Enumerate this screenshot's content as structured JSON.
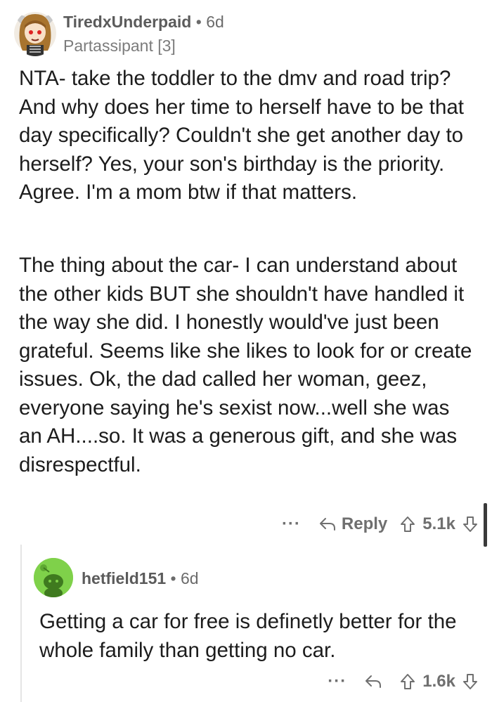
{
  "comment": {
    "username": "TiredxUnderpaid",
    "separator": "•",
    "time": "6d",
    "flair": "Partassipant [3]",
    "paragraphs": [
      "NTA- take the toddler to the dmv and road trip? And why does her time to herself have to be that day specifically? Couldn't she get another day to herself? Yes, your son's birthday is the priority. Agree. I'm a mom btw if that matters.",
      "The thing about the car- I can understand about the other kids BUT she shouldn't have handled it the way she did. I honestly would've just been grateful. Seems like she likes to look for or create issues. Ok, the dad called her woman, geez, everyone saying he's sexist now...well she was an AH....so. It was a generous gift, and she was disrespectful."
    ],
    "actions": {
      "more": "···",
      "reply_label": "Reply",
      "score": "5.1k"
    }
  },
  "reply": {
    "username": "hetfield151",
    "separator": "•",
    "time": "6d",
    "body": "Getting a car for free is definetly better for the whole family than getting no car.",
    "actions": {
      "more": "···",
      "score": "1.6k"
    }
  },
  "icons": {
    "reply": "reply-arrow-icon",
    "upvote": "upvote-arrow-icon",
    "downvote": "downvote-arrow-icon"
  },
  "colors": {
    "meta_text": "#6b6b6b",
    "body_text": "#1c1c1c",
    "reply_avatar_bg": "#7fd14a",
    "thread_line": "#e5e5e5"
  }
}
